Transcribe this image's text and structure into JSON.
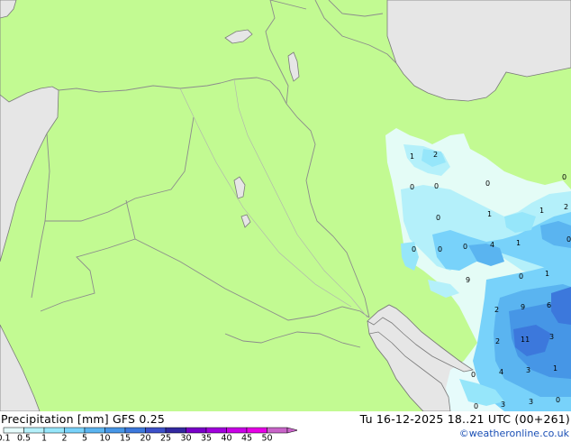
{
  "header": {
    "title": "Precipitation [mm]",
    "model": "GFS 0.25",
    "valid_time": "Tu 16-12-2025 18..21 UTC (00+261)",
    "credit": "©weatheronline.co.uk"
  },
  "colors": {
    "land": "#c2fa92",
    "sea": "#e6e6e6",
    "border": "#8c8c8c",
    "coast": "#7a7a7a"
  },
  "legend": {
    "ticks": [
      "0.1",
      "0.5",
      "1",
      "2",
      "5",
      "10",
      "15",
      "20",
      "25",
      "30",
      "35",
      "40",
      "45",
      "50"
    ],
    "colors": [
      "#e6fcfc",
      "#b4f0fa",
      "#96e6fa",
      "#78d2fa",
      "#5ab4f0",
      "#4696e6",
      "#3c78dc",
      "#3c50c8",
      "#3228a0",
      "#7800c8",
      "#a000dc",
      "#c800e6",
      "#e600e6",
      "#c864c8"
    ]
  },
  "precip_labels": [
    {
      "v": "1"
    },
    {
      "v": "2"
    },
    {
      "v": "0"
    },
    {
      "v": "0"
    },
    {
      "v": "0"
    },
    {
      "v": "0"
    },
    {
      "v": "0"
    },
    {
      "v": "1"
    },
    {
      "v": "1"
    },
    {
      "v": "2"
    },
    {
      "v": "0"
    },
    {
      "v": "0"
    },
    {
      "v": "0"
    },
    {
      "v": "4"
    },
    {
      "v": "1"
    },
    {
      "v": "0"
    },
    {
      "v": "0"
    },
    {
      "v": "1"
    },
    {
      "v": "9"
    },
    {
      "v": "2"
    },
    {
      "v": "9"
    },
    {
      "v": "6"
    },
    {
      "v": "2"
    },
    {
      "v": "11"
    },
    {
      "v": "3"
    },
    {
      "v": "0"
    },
    {
      "v": "4"
    },
    {
      "v": "3"
    },
    {
      "v": "1"
    },
    {
      "v": "0"
    },
    {
      "v": "3"
    },
    {
      "v": "3"
    },
    {
      "v": "0"
    }
  ]
}
